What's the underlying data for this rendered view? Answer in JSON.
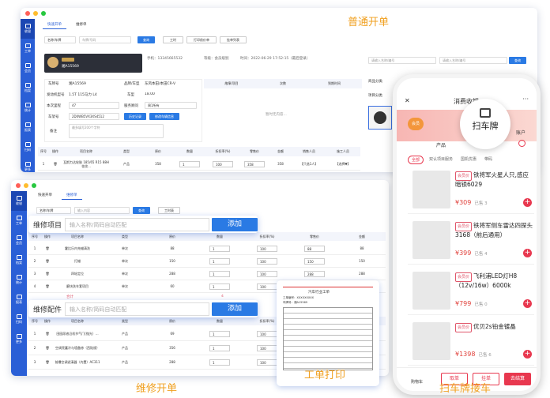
{
  "captions": {
    "normal": "普通开单",
    "repair": "维修开单",
    "print": "工单打印",
    "plate": "扫车牌接车"
  },
  "sidebar": [
    "收银",
    "工单",
    "会员",
    "档案",
    "统计",
    "报表",
    "扫码",
    "更多"
  ],
  "win1": {
    "tabs": [
      "快速开单",
      "维修单"
    ],
    "filter": "名称/车牌",
    "search_ph": "车牌/号码",
    "query": "查询",
    "buttons": [
      "工时",
      "打印前价单",
      "挂单列表"
    ],
    "car_plate": "湘A15569",
    "phone_label": "手机：13345665532",
    "member": "等级：会员级别",
    "time": "时间：2022-06-29 17:52:15（最后登录）",
    "form_labels": [
      "车牌号",
      "发动机型号",
      "本次里程",
      "车架号",
      "备注"
    ],
    "form_values": [
      "湘A15569",
      "1.5T 115马力 L4",
      "47",
      "2D0WB5VX3XS4512"
    ],
    "form_labels2": [
      "品牌/车型",
      "车型",
      "服务顾问"
    ],
    "form_values2": [
      "东风本田/本田CR-V",
      "18.00",
      "周1所有"
    ],
    "btn_a": "历史记录",
    "btn_b": "修改车辆信息",
    "remark_ph": "最多填写200个字符",
    "col_heads": [
      "故障/项目",
      "次数",
      "到期时间"
    ],
    "empty": "暂时无内容...",
    "table_heads": [
      "序号",
      "操作",
      "项目名称",
      "类型",
      "原价",
      "数量",
      "折扣率(%)",
      "零售价",
      "金额",
      "销售人员",
      "施工人员"
    ],
    "row": {
      "no": "1",
      "name": "瓦斯力达轮胎 185/65 R15 88H 花纹...",
      "type": "产品",
      "price": "358",
      "qty": "1",
      "disc": "100",
      "unit": "358",
      "amount": "358",
      "sales": "【只选1人】",
      "worker": "【选择▼】"
    },
    "right": {
      "search_ph": "请输入名称/编号",
      "query": "查询",
      "label1": "商品分类",
      "label2": "项目分类"
    }
  },
  "win2": {
    "tabs": [
      "快速开单",
      "维修单"
    ],
    "filter": "名称/车牌",
    "search_ph": "输入内容",
    "query": "查询",
    "btn": "工时表",
    "pop1": {
      "label": "维修项目",
      "ph": "输入名称/简码自动匹配",
      "btn": "添加"
    },
    "pop2": {
      "label": "维修配件",
      "ph": "输入名称/简码自动匹配",
      "btn": "添加"
    },
    "heads": [
      "序号",
      "操作",
      "项目名称",
      "类型",
      "原价",
      "数量",
      "折扣率(%)",
      "零售价",
      "金额"
    ],
    "rows": [
      {
        "no": "1",
        "name": "霍比乐内充蜡清洗",
        "type": "单次",
        "price": "88",
        "qty": "1",
        "disc": "100",
        "unit": "88",
        "amount": "88"
      },
      {
        "no": "2",
        "name": "打蜡",
        "type": "单次",
        "price": "150",
        "qty": "1",
        "disc": "100",
        "unit": "150",
        "amount": "150"
      },
      {
        "no": "3",
        "name": "四轮定位",
        "type": "单次",
        "price": "288",
        "qty": "1",
        "disc": "100",
        "unit": "288",
        "amount": "288"
      },
      {
        "no": "4",
        "name": "磨块洗车套项目",
        "type": "单次",
        "price": "60",
        "qty": "1",
        "disc": "100",
        "unit": "60",
        "amount": "60"
      }
    ],
    "total_label": "合计",
    "total_qty": "4",
    "rows2": [
      {
        "no": "1",
        "name": "田园尿液沿机节气门(抛光）...",
        "type": "产品",
        "price": "69",
        "qty": "1",
        "disc": "100",
        "unit": "69",
        "amount": "69"
      },
      {
        "no": "2",
        "name": "空调亮蓄冷与墙备修（西陆规）",
        "type": "产品",
        "price": "356",
        "qty": "1",
        "disc": "100",
        "unit": "356",
        "amount": "356"
      },
      {
        "no": "3",
        "name": "前爆空调滤清器（内置）AC311",
        "type": "产品",
        "price": "288",
        "qty": "1",
        "disc": "100",
        "unit": "288",
        "amount": "288"
      }
    ]
  },
  "print": {
    "title": "汽车行业工单",
    "line1": "工单编号：XXXXXXXXX",
    "line2": "车牌号：湘A15569"
  },
  "phone": {
    "title": "消费收银",
    "plate_label": "扫车牌",
    "member_badge": "会员",
    "tab": "产品",
    "account": "账户",
    "chips": [
      "全部",
      "双认项目服务",
      "国机优惠",
      "带码"
    ],
    "products": [
      {
        "badge": "会员价",
        "name": "铁将军火星人只,感应暗锁6029",
        "price": "¥309",
        "stock": "已售 3"
      },
      {
        "badge": "会员价",
        "name": "铁将军侧车雷达四探头3168（前后通用）",
        "price": "¥399",
        "stock": "已售 4"
      },
      {
        "badge": "会员价",
        "name": "飞利浦LED灯H8（12v/16w）6000k",
        "price": "¥799",
        "stock": "已售 0"
      },
      {
        "badge": "会员价",
        "name": "优贝2s铂金镀晶",
        "price": "¥1398",
        "stock": "已售 6"
      }
    ],
    "cart": "购物车",
    "cancel": "取单",
    "hold": "挂单",
    "checkout": "去结算"
  },
  "colors": {
    "primary": "#2a5fd6",
    "accent": "#f0a020",
    "red": "#e8384f"
  }
}
